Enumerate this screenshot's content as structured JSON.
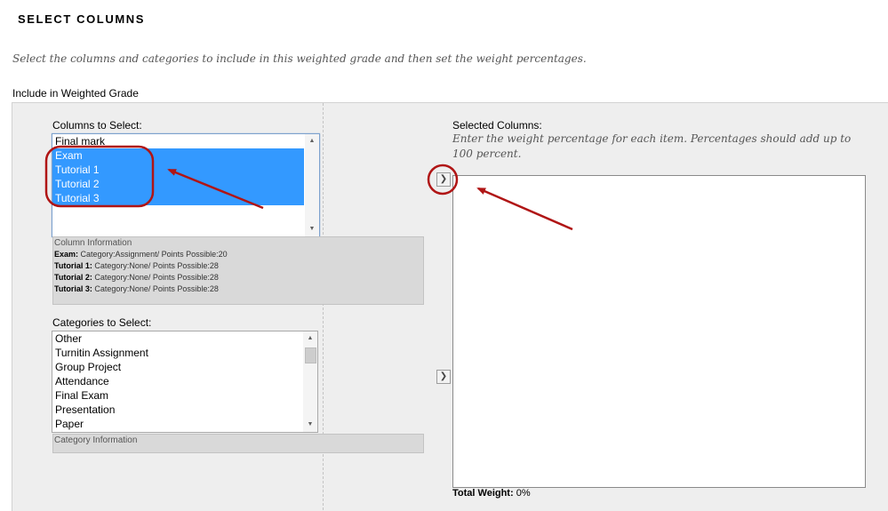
{
  "section_title": "SELECT COLUMNS",
  "instructions": "Select the columns and categories to include in this weighted grade and then set the weight percentages.",
  "include_label": "Include in Weighted Grade",
  "columns": {
    "label": "Columns to Select:",
    "items": [
      "Final mark",
      "Exam",
      "Tutorial 1",
      "Tutorial 2",
      "Tutorial 3"
    ],
    "selected": [
      "Exam",
      "Tutorial 1",
      "Tutorial 2",
      "Tutorial 3"
    ]
  },
  "column_info": {
    "header": "Column Information",
    "rows": [
      {
        "name": "Exam:",
        "detail": "Category:Assignment/ Points Possible:20"
      },
      {
        "name": "Tutorial 1:",
        "detail": "Category:None/ Points Possible:28"
      },
      {
        "name": "Tutorial 2:",
        "detail": "Category:None/ Points Possible:28"
      },
      {
        "name": "Tutorial 3:",
        "detail": "Category:None/ Points Possible:28"
      }
    ]
  },
  "categories": {
    "label": "Categories to Select:",
    "items": [
      "Other",
      "Turnitin Assignment",
      "Group Project",
      "Attendance",
      "Final Exam",
      "Presentation",
      "Paper"
    ]
  },
  "category_info": {
    "header": "Category Information"
  },
  "selected_columns": {
    "label": "Selected Columns:",
    "instructions": "Enter the weight percentage for each item. Percentages should add up to 100 percent."
  },
  "total_weight": {
    "label": "Total Weight:",
    "value": "0%"
  },
  "icons": {
    "add_button": "chevron-right-icon",
    "scroll_up": "triangle-up-icon",
    "scroll_down": "triangle-down-icon"
  },
  "colors": {
    "selection": "#3399ff",
    "annotation": "#b01515",
    "panel_bg": "#eeeeee"
  }
}
